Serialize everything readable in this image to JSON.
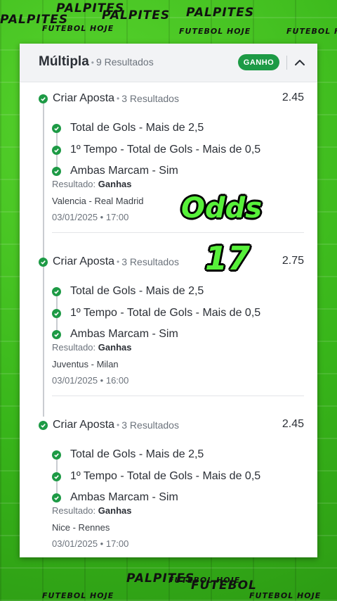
{
  "background": {
    "watermarks": [
      "PALPITES",
      "PALPITES",
      "PALPITES",
      "PALPITES",
      "FUTEBOL HOJE",
      "FUTEBOL HOJE",
      "FUTEBOL HOJE",
      "FUTEBOL HOJE",
      "PALPITES",
      "FUTEBOL",
      "FUTEBOL HOJE",
      "FUTEBOL HOJE"
    ],
    "color": "#3fc21f"
  },
  "card": {
    "title": "Múltipla",
    "results_count": "9 Resultados",
    "status_badge": "GANHO",
    "collapse_icon": "chevron-up-icon",
    "accent": "#1d9a45"
  },
  "bets": [
    {
      "title": "Criar Aposta",
      "count": "3 Resultados",
      "odd": "2.45",
      "selections": [
        "Total de Gols - Mais de 2,5",
        "1º Tempo - Total de Gols - Mais de 0,5",
        "Ambas Marcam - Sim"
      ],
      "result_label": "Resultado:",
      "result_value": "Ganhas",
      "match": "Valencia - Real Madrid",
      "datetime": "03/01/2025 • 17:00"
    },
    {
      "title": "Criar Aposta",
      "count": "3 Resultados",
      "odd": "2.75",
      "selections": [
        "Total de Gols - Mais de 2,5",
        "1º Tempo - Total de Gols - Mais de 0,5",
        "Ambas Marcam - Sim"
      ],
      "result_label": "Resultado:",
      "result_value": "Ganhas",
      "match": "Juventus - Milan",
      "datetime": "03/01/2025 • 16:00"
    },
    {
      "title": "Criar Aposta",
      "count": "3 Resultados",
      "odd": "2.45",
      "selections": [
        "Total de Gols - Mais de 2,5",
        "1º Tempo - Total de Gols - Mais de 0,5",
        "Ambas Marcam - Sim"
      ],
      "result_label": "Resultado:",
      "result_value": "Ganhas",
      "match": "Nice - Rennes",
      "datetime": "03/01/2025 • 17:00"
    }
  ],
  "overlay": {
    "odds_label": "Odds",
    "odds_value": "17",
    "color": "#57f03a"
  }
}
